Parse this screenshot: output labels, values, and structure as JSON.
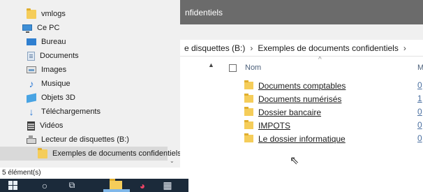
{
  "nav": {
    "items": [
      {
        "label": "vmlogs",
        "icon": "folder-icon"
      },
      {
        "label": "Ce PC",
        "icon": "pc-icon"
      },
      {
        "label": "Bureau",
        "icon": "desktop-icon"
      },
      {
        "label": "Documents",
        "icon": "documents-icon"
      },
      {
        "label": "Images",
        "icon": "images-icon"
      },
      {
        "label": "Musique",
        "icon": "music-icon"
      },
      {
        "label": "Objets 3D",
        "icon": "objects-3d-icon"
      },
      {
        "label": "Téléchargements",
        "icon": "download-icon"
      },
      {
        "label": "Vidéos",
        "icon": "video-icon"
      },
      {
        "label": "Lecteur de disquettes (B:)",
        "icon": "floppy-drive-icon"
      },
      {
        "label": "Exemples de documents confidentiels",
        "icon": "folder-icon",
        "selected": true
      }
    ]
  },
  "window": {
    "title": "nfidentiels"
  },
  "address": {
    "segments": [
      "e disquettes (B:)",
      "Exemples de documents confidentiels"
    ],
    "separator": "›"
  },
  "columns": {
    "name": "Nom",
    "modified_partial": "M"
  },
  "files": [
    {
      "name": "Documents comptables",
      "date_partial": "0"
    },
    {
      "name": "Documents numérisés",
      "date_partial": "1"
    },
    {
      "name": "Dossier bancaire",
      "date_partial": "0"
    },
    {
      "name": "IMPOTS",
      "date_partial": "0"
    },
    {
      "name": "Le dossier informatique",
      "date_partial": "0"
    }
  ],
  "status": {
    "item_count": "5 élément(s)"
  },
  "colors": {
    "title_bar": "#6b6b6b",
    "nav_bg": "#f0f0f0",
    "selected": "#d9d9d9",
    "taskbar": "#1b2a3a",
    "folder": "#f5cd5a"
  }
}
